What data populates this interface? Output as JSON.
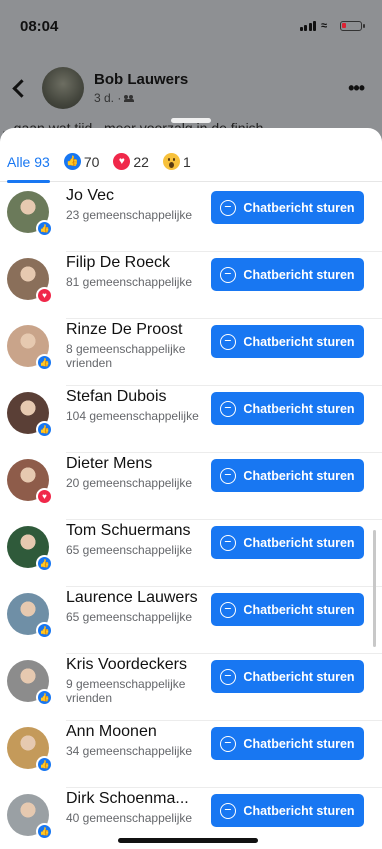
{
  "status_bar": {
    "time": "08:04"
  },
  "post": {
    "author": "Bob Lauwers",
    "age": "3 d. ·",
    "text_snippet": "...gaan wat tijd...meer voorzalg in de finish..."
  },
  "tabs": [
    {
      "label": "Alle 93"
    },
    {
      "label": "70",
      "reaction": "like"
    },
    {
      "label": "22",
      "reaction": "love"
    },
    {
      "label": "1",
      "reaction": "wow"
    }
  ],
  "button_label": "Chatbericht sturen",
  "people": [
    {
      "name": "Jo Vec",
      "mutual": "23 gemeenschappelijke",
      "reaction": "like",
      "avatar_color": "#6b7a5a"
    },
    {
      "name": "Filip De Roeck",
      "mutual": "81 gemeenschappelijke",
      "reaction": "love",
      "avatar_color": "#8a6f5a"
    },
    {
      "name": "Rinze De Proost",
      "mutual": "8 gemeenschappelijke vrienden",
      "reaction": "like",
      "avatar_color": "#c9a48a"
    },
    {
      "name": "Stefan Dubois",
      "mutual": "104 gemeenschappelijke",
      "reaction": "like",
      "avatar_color": "#5a3f36"
    },
    {
      "name": "Dieter Mens",
      "mutual": "20 gemeenschappelijke",
      "reaction": "love",
      "avatar_color": "#8e5c4a"
    },
    {
      "name": "Tom Schuermans",
      "mutual": "65 gemeenschappelijke",
      "reaction": "like",
      "avatar_color": "#2f5a3a"
    },
    {
      "name": "Laurence Lauwers",
      "mutual": "65 gemeenschappelijke",
      "reaction": "like",
      "avatar_color": "#6f8fa6"
    },
    {
      "name": "Kris Voordeckers",
      "mutual": "9 gemeenschappelijke vrienden",
      "reaction": "like",
      "avatar_color": "#8c8c8c"
    },
    {
      "name": "Ann Moonen",
      "mutual": "34 gemeenschappelijke",
      "reaction": "like",
      "avatar_color": "#c49a5a"
    },
    {
      "name": "Dirk Schoenma...",
      "mutual": "40 gemeenschappelijke",
      "reaction": "like",
      "avatar_color": "#9aa0a4"
    }
  ],
  "colors": {
    "accent": "#1877f2",
    "love": "#f0284a",
    "wow": "#f7c13c"
  }
}
